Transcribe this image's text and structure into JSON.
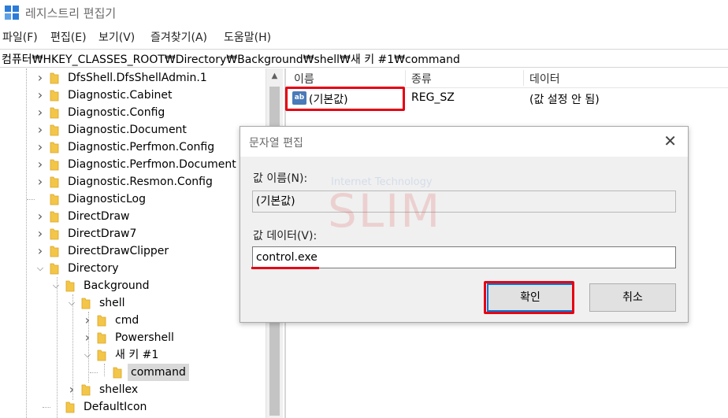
{
  "window": {
    "title": "레지스트리 편집기",
    "menu": [
      "파일(F)",
      "편집(E)",
      "보기(V)",
      "즐겨찾기(A)",
      "도움말(H)"
    ],
    "address": "컴퓨터₩HKEY_CLASSES_ROOT₩Directory₩Background₩shell₩새 키 #1₩command"
  },
  "tree": {
    "items": [
      {
        "label": "DfsShell.DfsShellAdmin.1",
        "level": 0,
        "expander": "collapsed"
      },
      {
        "label": "Diagnostic.Cabinet",
        "level": 0,
        "expander": "collapsed"
      },
      {
        "label": "Diagnostic.Config",
        "level": 0,
        "expander": "collapsed"
      },
      {
        "label": "Diagnostic.Document",
        "level": 0,
        "expander": "collapsed"
      },
      {
        "label": "Diagnostic.Perfmon.Config",
        "level": 0,
        "expander": "collapsed"
      },
      {
        "label": "Diagnostic.Perfmon.Document",
        "level": 0,
        "expander": "collapsed"
      },
      {
        "label": "Diagnostic.Resmon.Config",
        "level": 0,
        "expander": "collapsed"
      },
      {
        "label": "DiagnosticLog",
        "level": 0,
        "expander": "none"
      },
      {
        "label": "DirectDraw",
        "level": 0,
        "expander": "collapsed"
      },
      {
        "label": "DirectDraw7",
        "level": 0,
        "expander": "collapsed"
      },
      {
        "label": "DirectDrawClipper",
        "level": 0,
        "expander": "collapsed"
      },
      {
        "label": "Directory",
        "level": 0,
        "expander": "expanded"
      },
      {
        "label": "Background",
        "level": 1,
        "expander": "expanded"
      },
      {
        "label": "shell",
        "level": 2,
        "expander": "expanded"
      },
      {
        "label": "cmd",
        "level": 3,
        "expander": "collapsed"
      },
      {
        "label": "Powershell",
        "level": 3,
        "expander": "collapsed"
      },
      {
        "label": "새 키 #1",
        "level": 3,
        "expander": "expanded"
      },
      {
        "label": "command",
        "level": 4,
        "expander": "none",
        "selected": true
      },
      {
        "label": "shellex",
        "level": 2,
        "expander": "collapsed"
      },
      {
        "label": "DefaultIcon",
        "level": 1,
        "expander": "none"
      }
    ]
  },
  "list": {
    "columns": [
      "이름",
      "종류",
      "데이터"
    ],
    "rows": [
      {
        "icon": "string-value-icon",
        "icon_text": "ab",
        "name": "(기본값)",
        "type": "REG_SZ",
        "data": "(값 설정 안 됨)"
      }
    ]
  },
  "dialog": {
    "title": "문자열 편집",
    "close_glyph": "✕",
    "name_label": "값 이름(N):",
    "name_value": "(기본값)",
    "data_label": "값 데이터(V):",
    "data_value": "control.exe",
    "ok_label": "확인",
    "cancel_label": "취소"
  },
  "watermark": {
    "top_text": "Internet Technology",
    "main_text": "SLIM"
  },
  "colors": {
    "highlight_red": "#e60012",
    "folder_yellow": "#f3c64a",
    "accent_blue": "#0078d7"
  }
}
